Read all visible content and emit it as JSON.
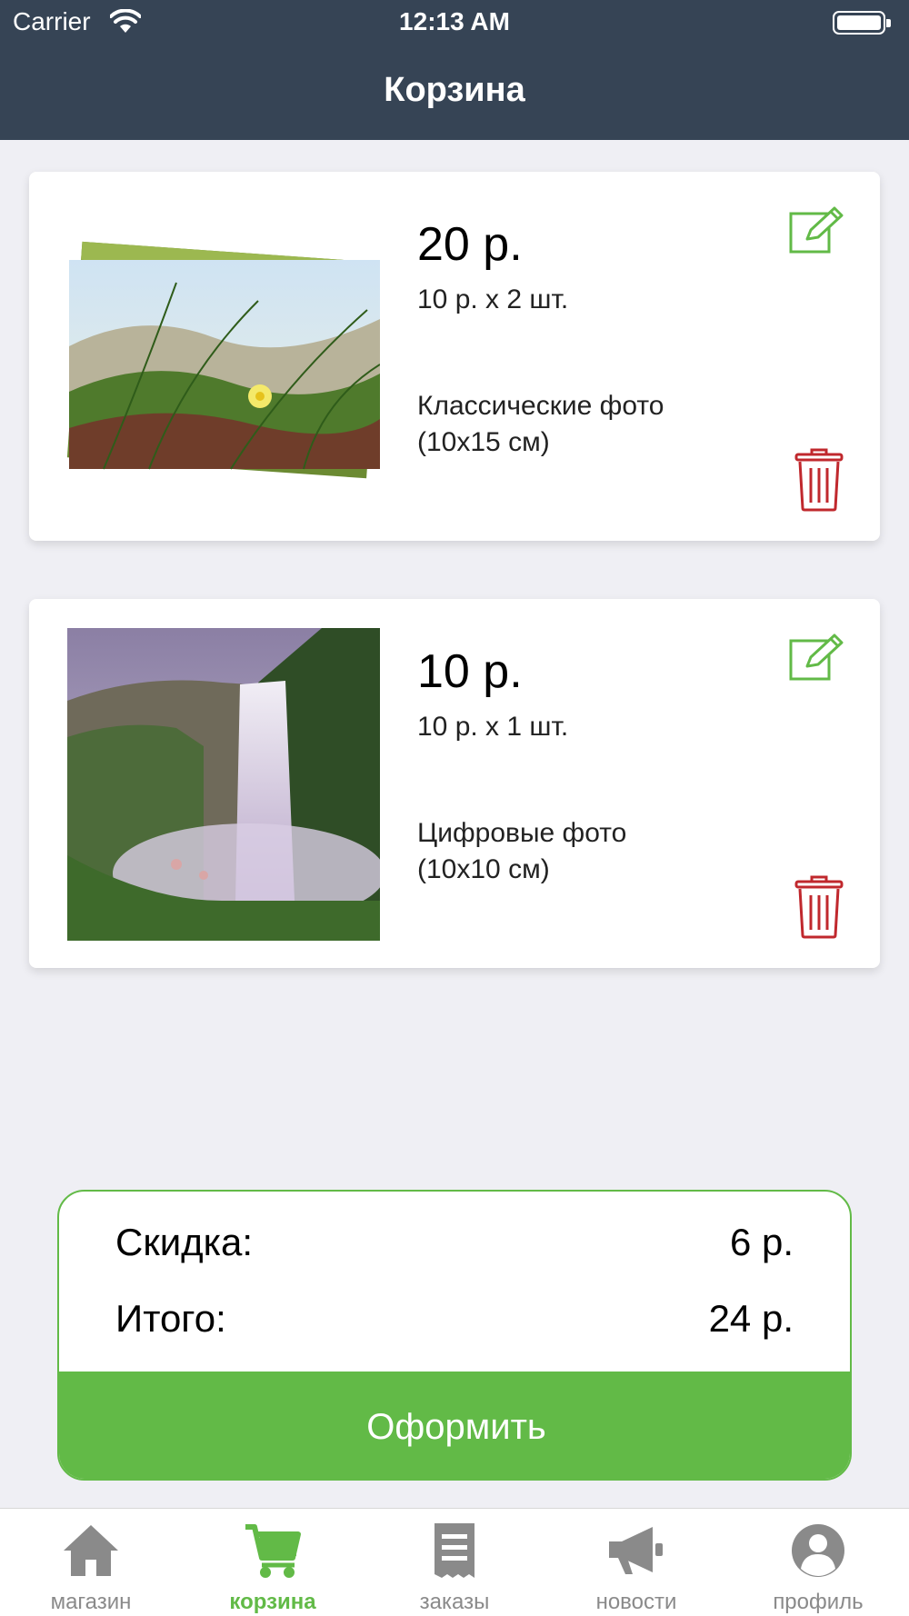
{
  "status_bar": {
    "carrier": "Carrier",
    "time": "12:13 AM"
  },
  "header": {
    "title": "Корзина"
  },
  "cart": {
    "items": [
      {
        "price": "20 р.",
        "unit_line": "10 р. x 2 шт.",
        "product_line1": "Классические фото",
        "product_line2": "(10x15 см)"
      },
      {
        "price": "10 р.",
        "unit_line": "10 р. x 1 шт.",
        "product_line1": "Цифровые фото",
        "product_line2": "(10x10 см)"
      }
    ]
  },
  "summary": {
    "discount_label": "Скидка:",
    "discount_value": "6 р.",
    "total_label": "Итого:",
    "total_value": "24 р.",
    "checkout_label": "Оформить"
  },
  "tabbar": {
    "tabs": [
      {
        "label": "магазин",
        "icon": "home-icon"
      },
      {
        "label": "корзина",
        "icon": "cart-icon",
        "active": true
      },
      {
        "label": "заказы",
        "icon": "receipt-icon"
      },
      {
        "label": "новости",
        "icon": "megaphone-icon"
      },
      {
        "label": "профиль",
        "icon": "profile-icon"
      }
    ]
  },
  "colors": {
    "header_bg": "#364455",
    "accent": "#62ba47",
    "delete": "#c0282d",
    "tab_inactive": "#8a8a8a"
  }
}
